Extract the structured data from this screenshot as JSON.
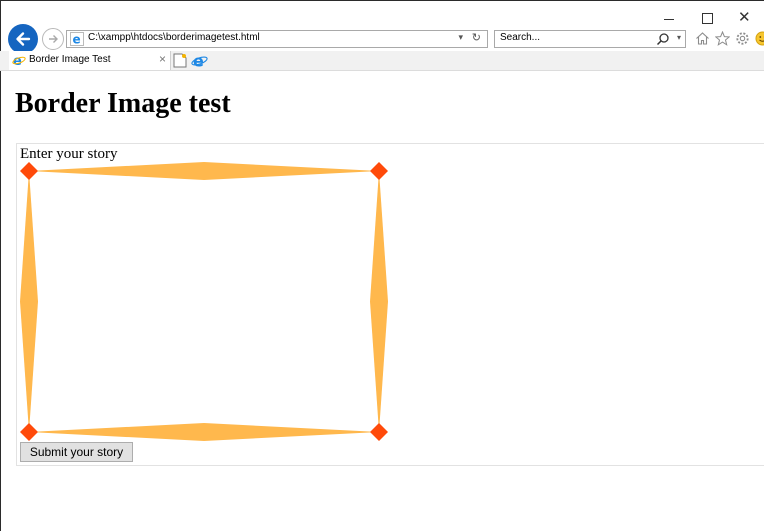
{
  "browser": {
    "address": "C:\\xampp\\htdocs\\borderimagetest.html",
    "search_placeholder": "Search...",
    "tab_title": "Border Image Test",
    "tab_close_glyph": "×",
    "addr_dropdown_glyph": "▾",
    "refresh_glyph": "↻",
    "search_dropdown_glyph": "▾",
    "close_glyph": "✕",
    "icons": [
      "back-arrow-icon",
      "forward-arrow-icon",
      "ie-logo-icon",
      "search-icon",
      "home-icon",
      "favorites-star-icon",
      "settings-gear-icon",
      "smiley-feedback-icon",
      "new-tab-icon"
    ]
  },
  "page": {
    "heading": "Border Image test",
    "story_label": "Enter your story",
    "submit_label": "Submit your story"
  },
  "colors": {
    "border_orange": "#ffb84d",
    "corner_red_orange": "#ff4a0a",
    "back_button_blue": "#1565c0"
  }
}
